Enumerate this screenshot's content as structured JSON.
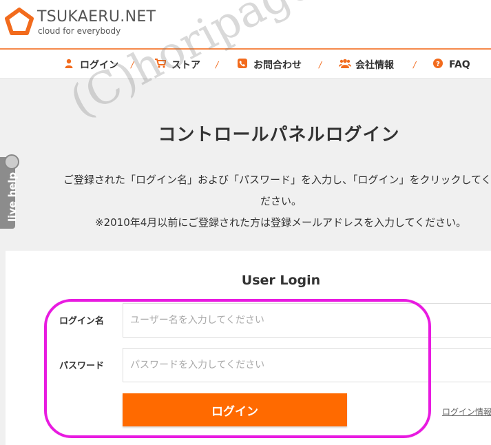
{
  "header": {
    "logo_name": "TSUKAERU.NET",
    "logo_tagline": "cloud for everybody"
  },
  "nav": {
    "items": [
      {
        "label": "ログイン",
        "icon": "user-icon"
      },
      {
        "label": "ストア",
        "icon": "cart-icon"
      },
      {
        "label": "お問合わせ",
        "icon": "phone-icon"
      },
      {
        "label": "会社情報",
        "icon": "group-icon"
      },
      {
        "label": "FAQ",
        "icon": "question-icon"
      }
    ],
    "separator": "/"
  },
  "watermark": "(C)horipage",
  "page": {
    "title": "コントロールパネルログイン",
    "desc_line1": "ご登録された「ログイン名」および「パスワード」を入力し、「ログイン」をクリックしてく",
    "desc_line2": "ださい。",
    "desc_line3": "※2010年4月以前にご登録された方は登録メールアドレスを入力してください。"
  },
  "live_help": {
    "label": "live help"
  },
  "login": {
    "heading": "User Login",
    "username_label": "ログイン名",
    "username_placeholder": "ユーザー名を入力してください",
    "password_label": "パスワード",
    "password_placeholder": "パスワードを入力してください",
    "submit_label": "ログイン",
    "info_link": "ログイン情報"
  },
  "colors": {
    "accent": "#ff6a00",
    "highlight": "#e81be0"
  }
}
